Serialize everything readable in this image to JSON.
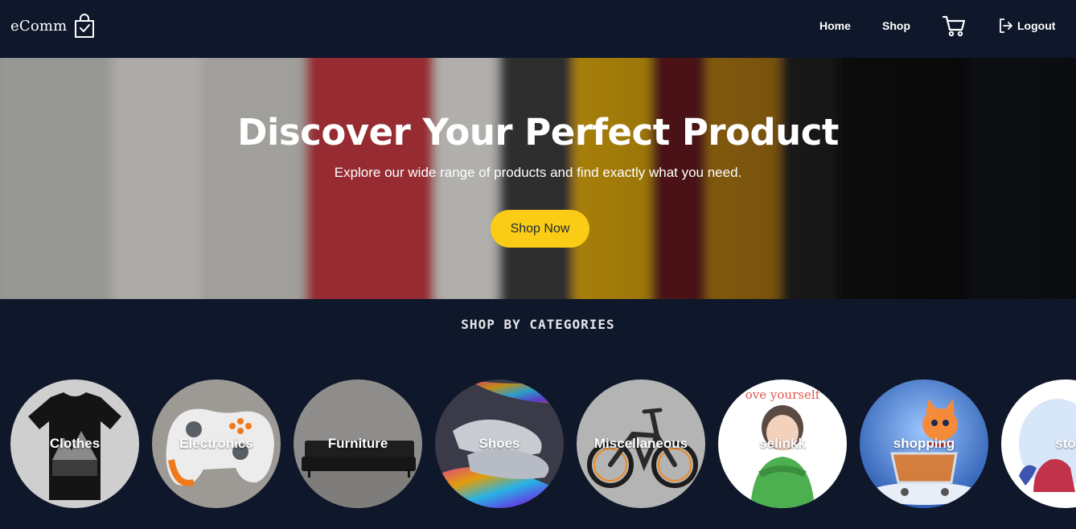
{
  "navbar": {
    "brand": "eComm",
    "links": {
      "home": "Home",
      "shop": "Shop",
      "logout": "Logout"
    }
  },
  "hero": {
    "title": "Discover Your Perfect Product",
    "subtitle": "Explore our wide range of products and find exactly what you need.",
    "cta": "Shop Now"
  },
  "categories": {
    "heading": "SHOP BY CATEGORIES",
    "items": [
      {
        "label": "Clothes"
      },
      {
        "label": "Electronics"
      },
      {
        "label": "Furniture"
      },
      {
        "label": "Shoes"
      },
      {
        "label": "Miscellaneous"
      },
      {
        "label": "selinkk"
      },
      {
        "label": "shopping"
      },
      {
        "label": "sto"
      }
    ]
  },
  "colors": {
    "background": "#0f172a",
    "accent": "#facc15",
    "text": "#ffffff"
  },
  "icons": [
    "shopping-bag-icon",
    "cart-icon",
    "logout-icon"
  ]
}
